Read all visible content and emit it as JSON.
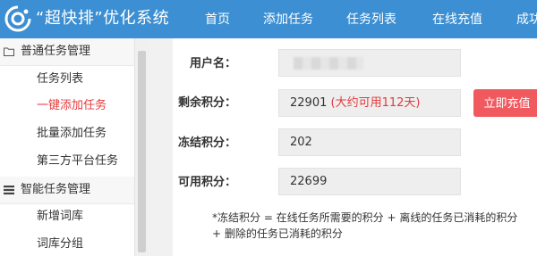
{
  "header": {
    "logo_text": "“超快排”优化系统",
    "nav": [
      "首页",
      "添加任务",
      "任务列表",
      "在线充值",
      "成功"
    ]
  },
  "sidebar": {
    "sections": [
      {
        "label": "普通任务管理",
        "icon": "folder-icon",
        "items": [
          "任务列表",
          "一键添加任务",
          "批量添加任务",
          "第三方平台任务"
        ]
      },
      {
        "label": "智能任务管理",
        "icon": "list-icon",
        "items": [
          "新增词库",
          "词库分组"
        ]
      }
    ],
    "active_item": "一键添加任务"
  },
  "main": {
    "username": {
      "label": "用户名：",
      "value": ""
    },
    "remaining": {
      "label": "剩余积分：",
      "value": "22901",
      "note": "(大约可用112天)"
    },
    "frozen": {
      "label": "冻结积分：",
      "value": "202"
    },
    "available": {
      "label": "可用积分：",
      "value": "22699"
    },
    "recharge_button": "立即充值",
    "footnote_line1": "*冻结积分 = 在线任务所需要的积分 + 离线的任务已消耗的积分",
    "footnote_line2": "+ 删除的任务已消耗的积分"
  },
  "colors": {
    "header_bg": "#3c8fd2",
    "active_text": "#e4393c",
    "button_bg": "#f05a5f"
  }
}
